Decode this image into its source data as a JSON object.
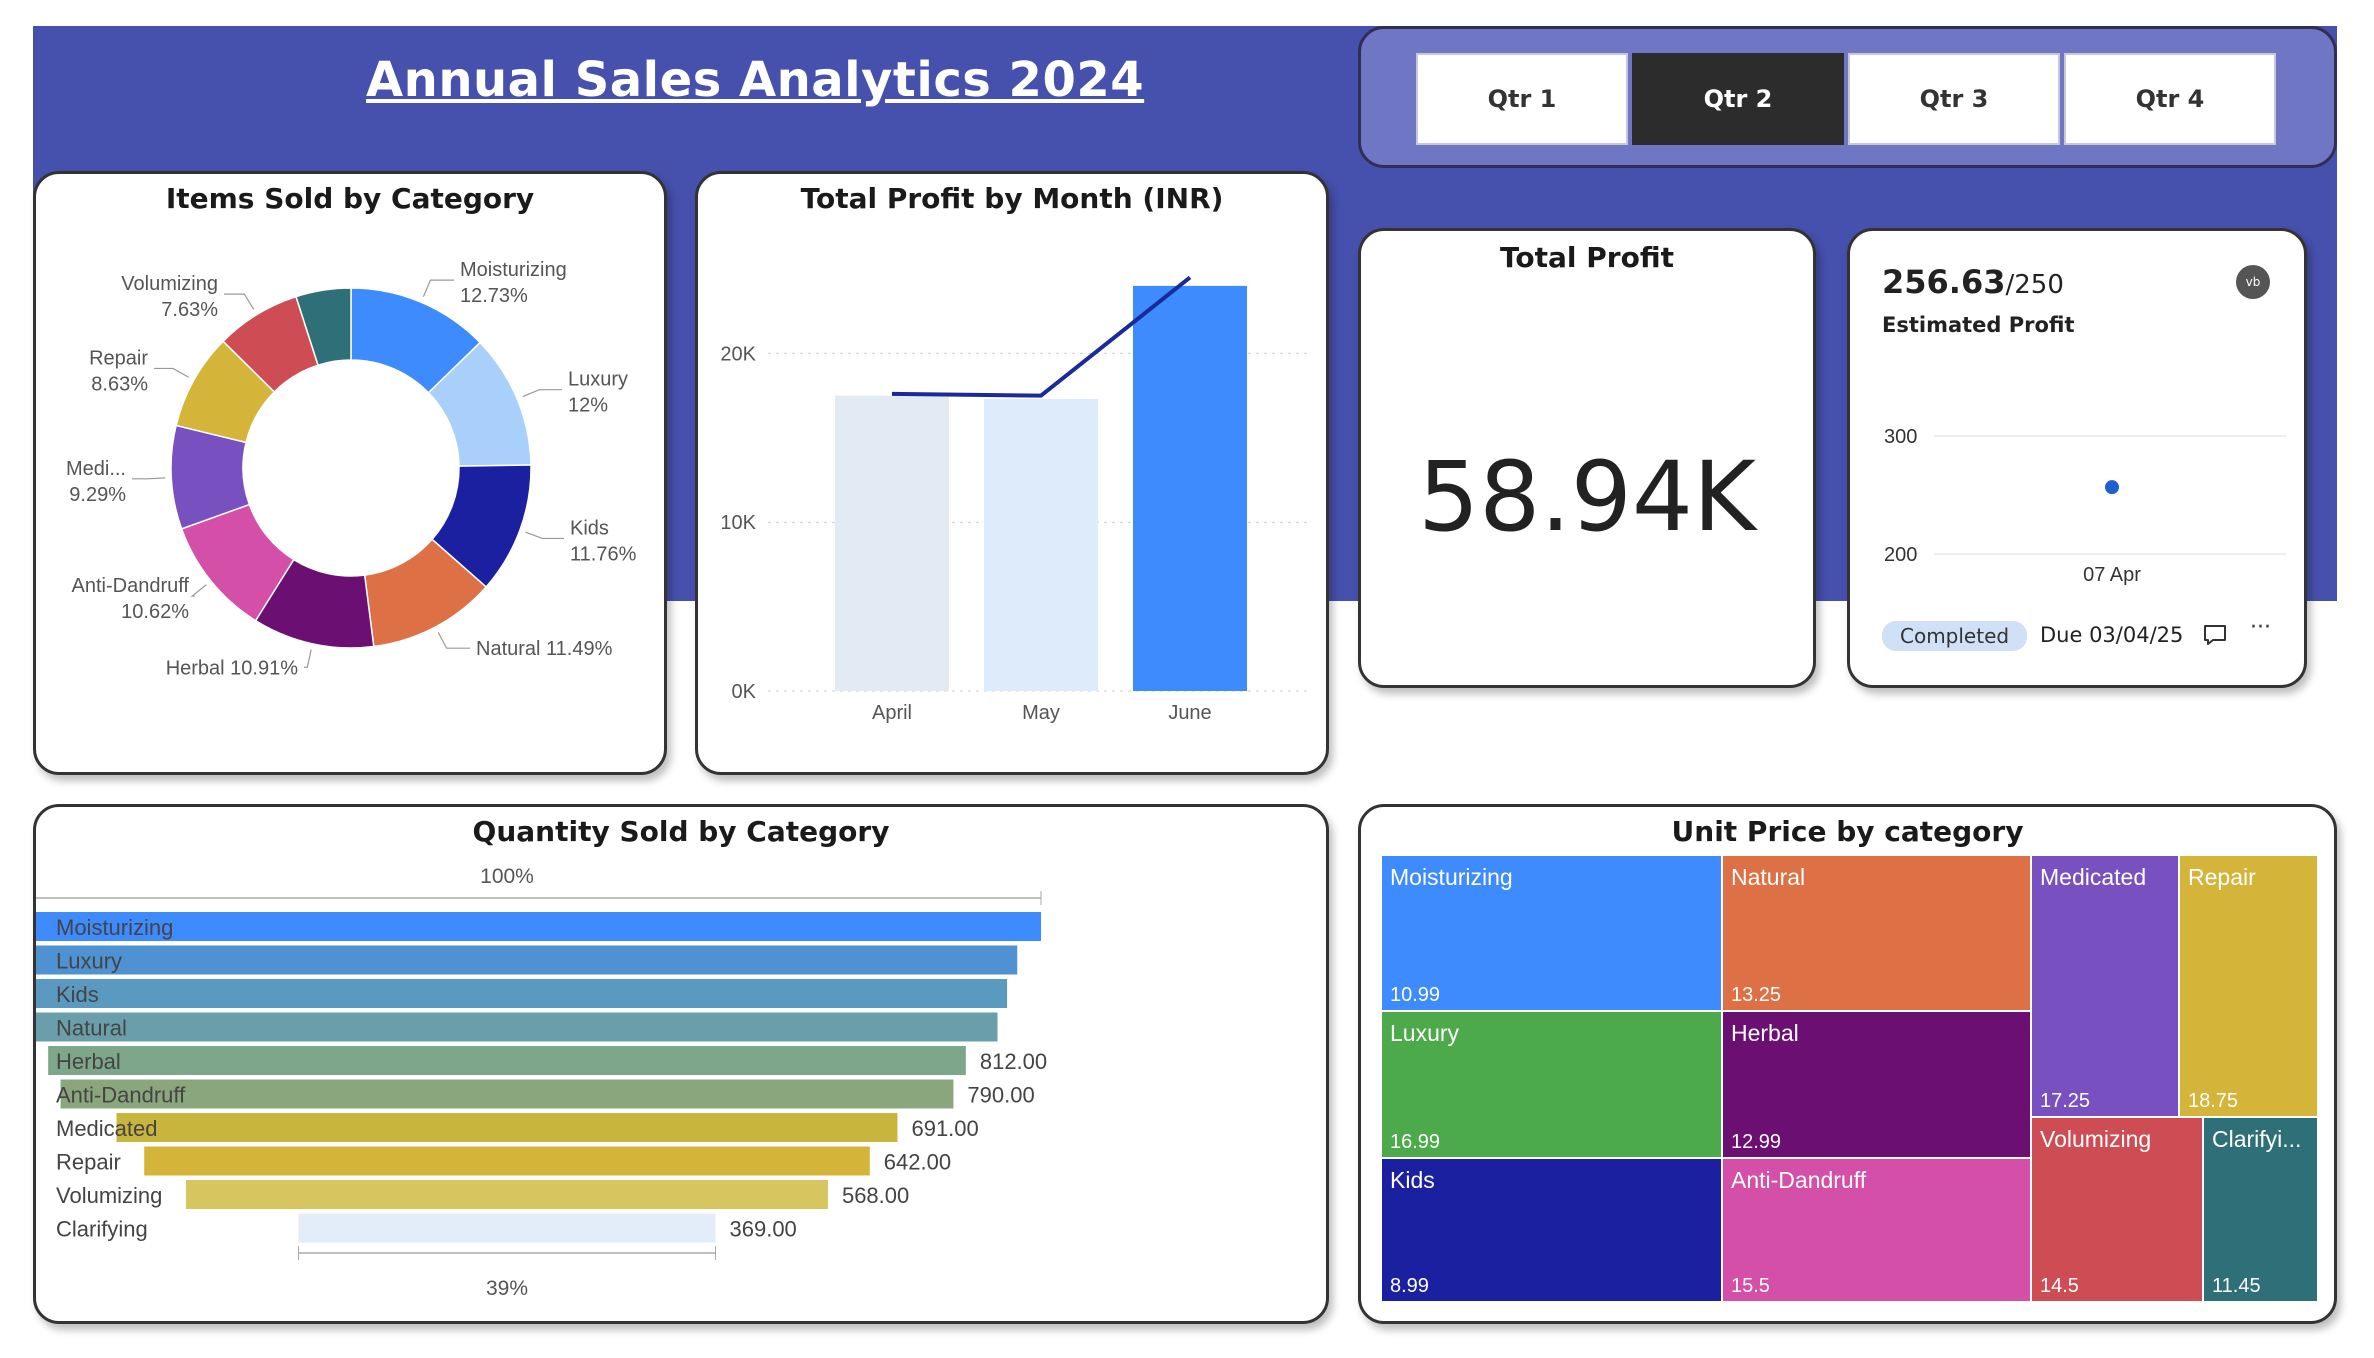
{
  "title": "Annual Sales Analytics 2024",
  "quarters": {
    "labels": [
      "Qtr 1",
      "Qtr 2",
      "Qtr 3",
      "Qtr 4"
    ],
    "selected": "Qtr 2"
  },
  "colors": {
    "banner": "#4650ad",
    "qtr_panel": "#6f76c4",
    "Moisturizing": "#3d8bfd",
    "Luxury": "#a9cffb",
    "Kids": "#1a20a0",
    "Natural": "#dd7044",
    "Herbal": "#6b0f72",
    "Anti-Dandruff": "#d44fa8",
    "Medicated": "#7850c0",
    "Repair": "#d5b43a",
    "Volumizing": "#ce4d55",
    "Clarifying": "#2f7078",
    "Luxury_treemap": "#4caa4a"
  },
  "donut": {
    "title": "Items Sold by Category",
    "chart_data": {
      "type": "pie",
      "title": "Items Sold by Category",
      "slices": [
        {
          "label": "Moisturizing",
          "value": 12.73,
          "text": "12.73%"
        },
        {
          "label": "Luxury",
          "value": 12.0,
          "text": "12%"
        },
        {
          "label": "Kids",
          "value": 11.76,
          "text": "11.76%"
        },
        {
          "label": "Natural",
          "value": 11.49,
          "text": "11.49%"
        },
        {
          "label": "Herbal",
          "value": 10.91,
          "text": "10.91%"
        },
        {
          "label": "Anti-Dandruff",
          "value": 10.62,
          "text": "10.62%"
        },
        {
          "label": "Medi...",
          "value": 9.29,
          "text": "9.29%"
        },
        {
          "label": "Repair",
          "value": 8.63,
          "text": "8.63%"
        },
        {
          "label": "Volumizing",
          "value": 7.63,
          "text": "7.63%"
        },
        {
          "label": "",
          "value": 4.94,
          "text": ""
        }
      ]
    }
  },
  "profit_chart": {
    "title": "Total Profit by Month (INR)",
    "chart_data": {
      "type": "bar",
      "categories": [
        "April",
        "May",
        "June"
      ],
      "values": [
        17500,
        17300,
        24000
      ],
      "line_values": [
        17600,
        17500,
        24500
      ],
      "ylim": [
        0,
        25000
      ],
      "yticks": [
        "0K",
        "10K",
        "20K"
      ]
    }
  },
  "kpi": {
    "title": "Total Profit",
    "value": "58.94K"
  },
  "goal": {
    "value": "256.63",
    "target": "/250",
    "name": "Estimated Profit",
    "avatar": "vb",
    "y_ticks": [
      "300",
      "200"
    ],
    "point_label": "07 Apr",
    "point_value": 256.63,
    "status": "Completed",
    "due": "Due 03/04/25",
    "more": "···"
  },
  "funnel": {
    "title": "Quantity Sold by Category",
    "top_pct": "100%",
    "bottom_pct": "39%",
    "chart_data": {
      "type": "bar",
      "categories": [
        "Moisturizing",
        "Luxury",
        "Kids",
        "Natural",
        "Herbal",
        "Anti-Dandruff",
        "Medicated",
        "Repair",
        "Volumizing",
        "Clarifying"
      ],
      "values": [
        945,
        903,
        885,
        868,
        812,
        790,
        691,
        642,
        568,
        369
      ],
      "labels": [
        "",
        "",
        "",
        "",
        "812.00",
        "790.00",
        "691.00",
        "642.00",
        "568.00",
        "369.00"
      ],
      "colors": [
        "#3d8bfd",
        "#4f92d2",
        "#5a9ac0",
        "#6a9eaa",
        "#7ea68a",
        "#89a67c",
        "#c7b53e",
        "#d5b43a",
        "#d7c660",
        "#e3edf9"
      ]
    }
  },
  "treemap": {
    "title": "Unit Price by category",
    "tiles": [
      {
        "name": "Moisturizing",
        "value": "10.99"
      },
      {
        "name": "Natural",
        "value": "13.25"
      },
      {
        "name": "Medicated",
        "value": "17.25"
      },
      {
        "name": "Repair",
        "value": "18.75"
      },
      {
        "name": "Luxury",
        "value": "16.99"
      },
      {
        "name": "Herbal",
        "value": "12.99"
      },
      {
        "name": "Volumizing",
        "value": "14.5"
      },
      {
        "name": "Clarifyi...",
        "value": "11.45"
      },
      {
        "name": "Kids",
        "value": "8.99"
      },
      {
        "name": "Anti-Dandruff",
        "value": "15.5"
      }
    ]
  }
}
